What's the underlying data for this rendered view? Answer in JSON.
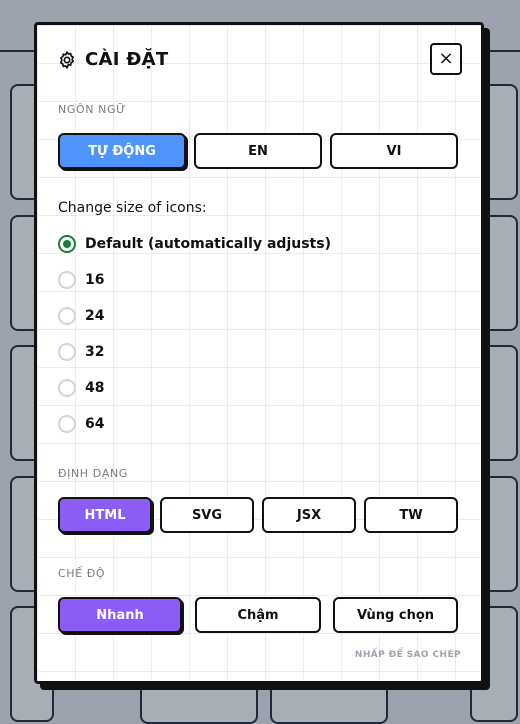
{
  "settings": {
    "title": "CÀI ĐẶT",
    "close_symbol": "×",
    "language": {
      "label": "NGÔN NGỮ",
      "options": [
        "TỰ ĐỘNG",
        "EN",
        "VI"
      ],
      "selected": "TỰ ĐỘNG"
    },
    "icon_size": {
      "question": "Change size of icons:",
      "options": [
        "Default (automatically adjusts)",
        "16",
        "24",
        "32",
        "48",
        "64"
      ],
      "selected": "Default (automatically adjusts)"
    },
    "format": {
      "label": "ĐỊNH DẠNG",
      "options": [
        "HTML",
        "SVG",
        "JSX",
        "TW"
      ],
      "selected": "HTML"
    },
    "mode": {
      "label": "CHẾ ĐỘ",
      "options": [
        "Nhanh",
        "Chậm",
        "Vùng chọn"
      ],
      "selected": "Nhanh"
    },
    "hint": "NHẤP ĐỂ SAO CHÉP"
  },
  "colors": {
    "language_selected": "#4f94fb",
    "selected_accent": "#8b5cf6",
    "radio_selected": "#15803d"
  },
  "icons": {
    "settings": "gear-icon",
    "close": "close-icon"
  }
}
